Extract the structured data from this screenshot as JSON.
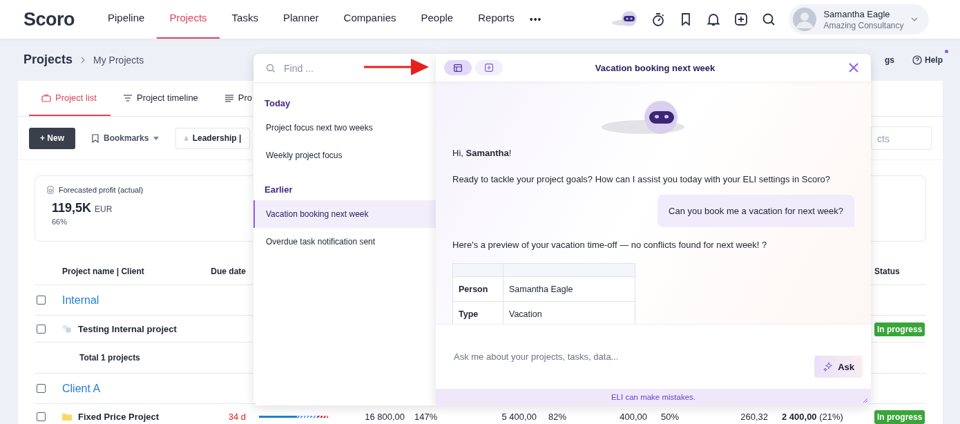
{
  "header": {
    "logo": "Scoro",
    "nav": [
      {
        "label": "Pipeline",
        "selected": false
      },
      {
        "label": "Projects",
        "selected": true
      },
      {
        "label": "Tasks",
        "selected": false
      },
      {
        "label": "Planner",
        "selected": false
      },
      {
        "label": "Companies",
        "selected": false
      },
      {
        "label": "People",
        "selected": false
      },
      {
        "label": "Reports",
        "selected": false
      }
    ],
    "more": "•••",
    "user": {
      "name": "Samantha Eagle",
      "company": "Amazing Consultancy"
    }
  },
  "breadcrumb": {
    "title": "Projects",
    "current": "My Projects",
    "settings_fragment": "gs",
    "help": "Help",
    "help_notification": true
  },
  "tabs": [
    {
      "label": "Project list",
      "selected": true
    },
    {
      "label": "Project timeline",
      "selected": false
    },
    {
      "label": "Pro",
      "selected": false
    }
  ],
  "toolbar": {
    "new_button": "+ New",
    "bookmarks": "Bookmarks",
    "filter": "Leadership |",
    "search_fragment": "cts"
  },
  "kpi": {
    "label": "Forecasted profit (actual)",
    "value": "119,5K",
    "unit": "EUR",
    "percent": "66%"
  },
  "table": {
    "columns": {
      "name": "Project name | Client",
      "due": "Due date",
      "status": "Status"
    },
    "rows": [
      {
        "kind": "group",
        "name": "Internal",
        "checked": false
      },
      {
        "kind": "project",
        "name": "Testing Internal project",
        "checked": false,
        "level": 0,
        "status": "In progress"
      },
      {
        "kind": "total",
        "name": "Total 1 projects"
      },
      {
        "kind": "group",
        "name": "Client A",
        "checked": false
      },
      {
        "kind": "project",
        "name": "Fixed Price Project",
        "checked": false,
        "due": "34 d",
        "level": 0.55,
        "values": [
          "16 800,00",
          "147%",
          "5 400,00",
          "82%",
          "400,00",
          "50%",
          "260,32"
        ],
        "profit": "2 400,00",
        "profit_pct": "(21%)",
        "status": "In progress"
      }
    ]
  },
  "history": {
    "search_placeholder": "Find ...",
    "groups": [
      {
        "title": "Today",
        "items": [
          {
            "label": "Project focus next two weeks",
            "selected": false
          },
          {
            "label": "Weekly project focus",
            "selected": false
          }
        ]
      },
      {
        "title": "Earlier",
        "items": [
          {
            "label": "Vacation booking next week",
            "selected": true
          },
          {
            "label": "Overdue task notification sent",
            "selected": false
          }
        ]
      }
    ]
  },
  "chat": {
    "title": "Vacation booking next week",
    "view_buttons": [
      {
        "selected": true
      },
      {
        "selected": false
      }
    ],
    "greeting": "Hi, **Samantha**!",
    "messages": [
      {
        "kind": "assistant",
        "text": "Ready to tackle your project goals? How can I assist you today with your ELI settings in Scoro?"
      },
      {
        "kind": "user",
        "text": "Can you book me a vacation for next week?"
      },
      {
        "kind": "assistant",
        "text": "Here's a preview of your vacation time-off — no conflicts found for next week! ?"
      }
    ],
    "table_rows": [
      [
        "Person",
        "Samantha Eagle"
      ],
      [
        "Type",
        "Vacation"
      ]
    ],
    "input_placeholder": "Ask me about your projects, tasks, data...",
    "ask_button": "Ask",
    "disclaimer": "ELI can make mistakes."
  }
}
